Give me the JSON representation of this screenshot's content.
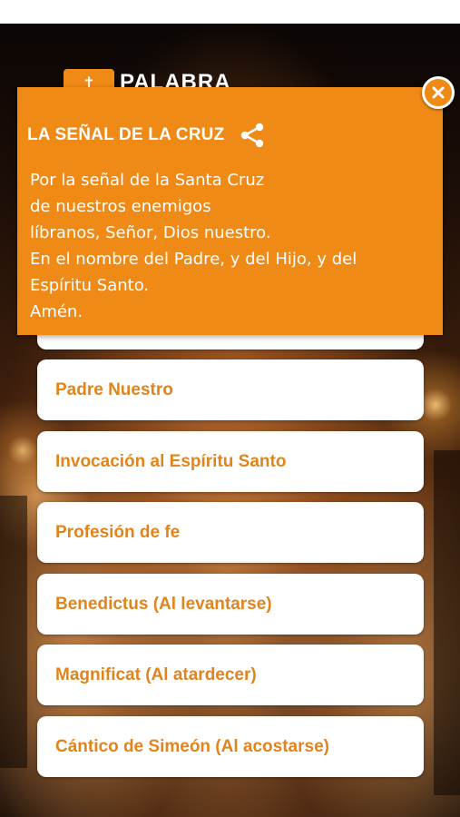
{
  "app": {
    "logo_text": "PALABRA"
  },
  "popup": {
    "title": "LA SEÑAL DE LA CRUZ",
    "lines": [
      "Por la señal de la Santa Cruz",
      "de nuestros enemigos",
      "líbranos, Señor, Dios nuestro.",
      "En el nombre del Padre, y del Hijo, y del",
      "Espíritu Santo.",
      "Amén."
    ]
  },
  "prayers": [
    {
      "label": ""
    },
    {
      "label": "Padre Nuestro"
    },
    {
      "label": "Invocación al Espíritu Santo"
    },
    {
      "label": "Profesión de fe"
    },
    {
      "label": "Benedictus (Al levantarse)"
    },
    {
      "label": "Magnificat (Al atardecer)"
    },
    {
      "label": "Cántico de Simeón (Al acostarse)"
    }
  ],
  "colors": {
    "accent": "#f08a16",
    "item_text": "#e2841c",
    "card_bg": "#ffffff"
  }
}
